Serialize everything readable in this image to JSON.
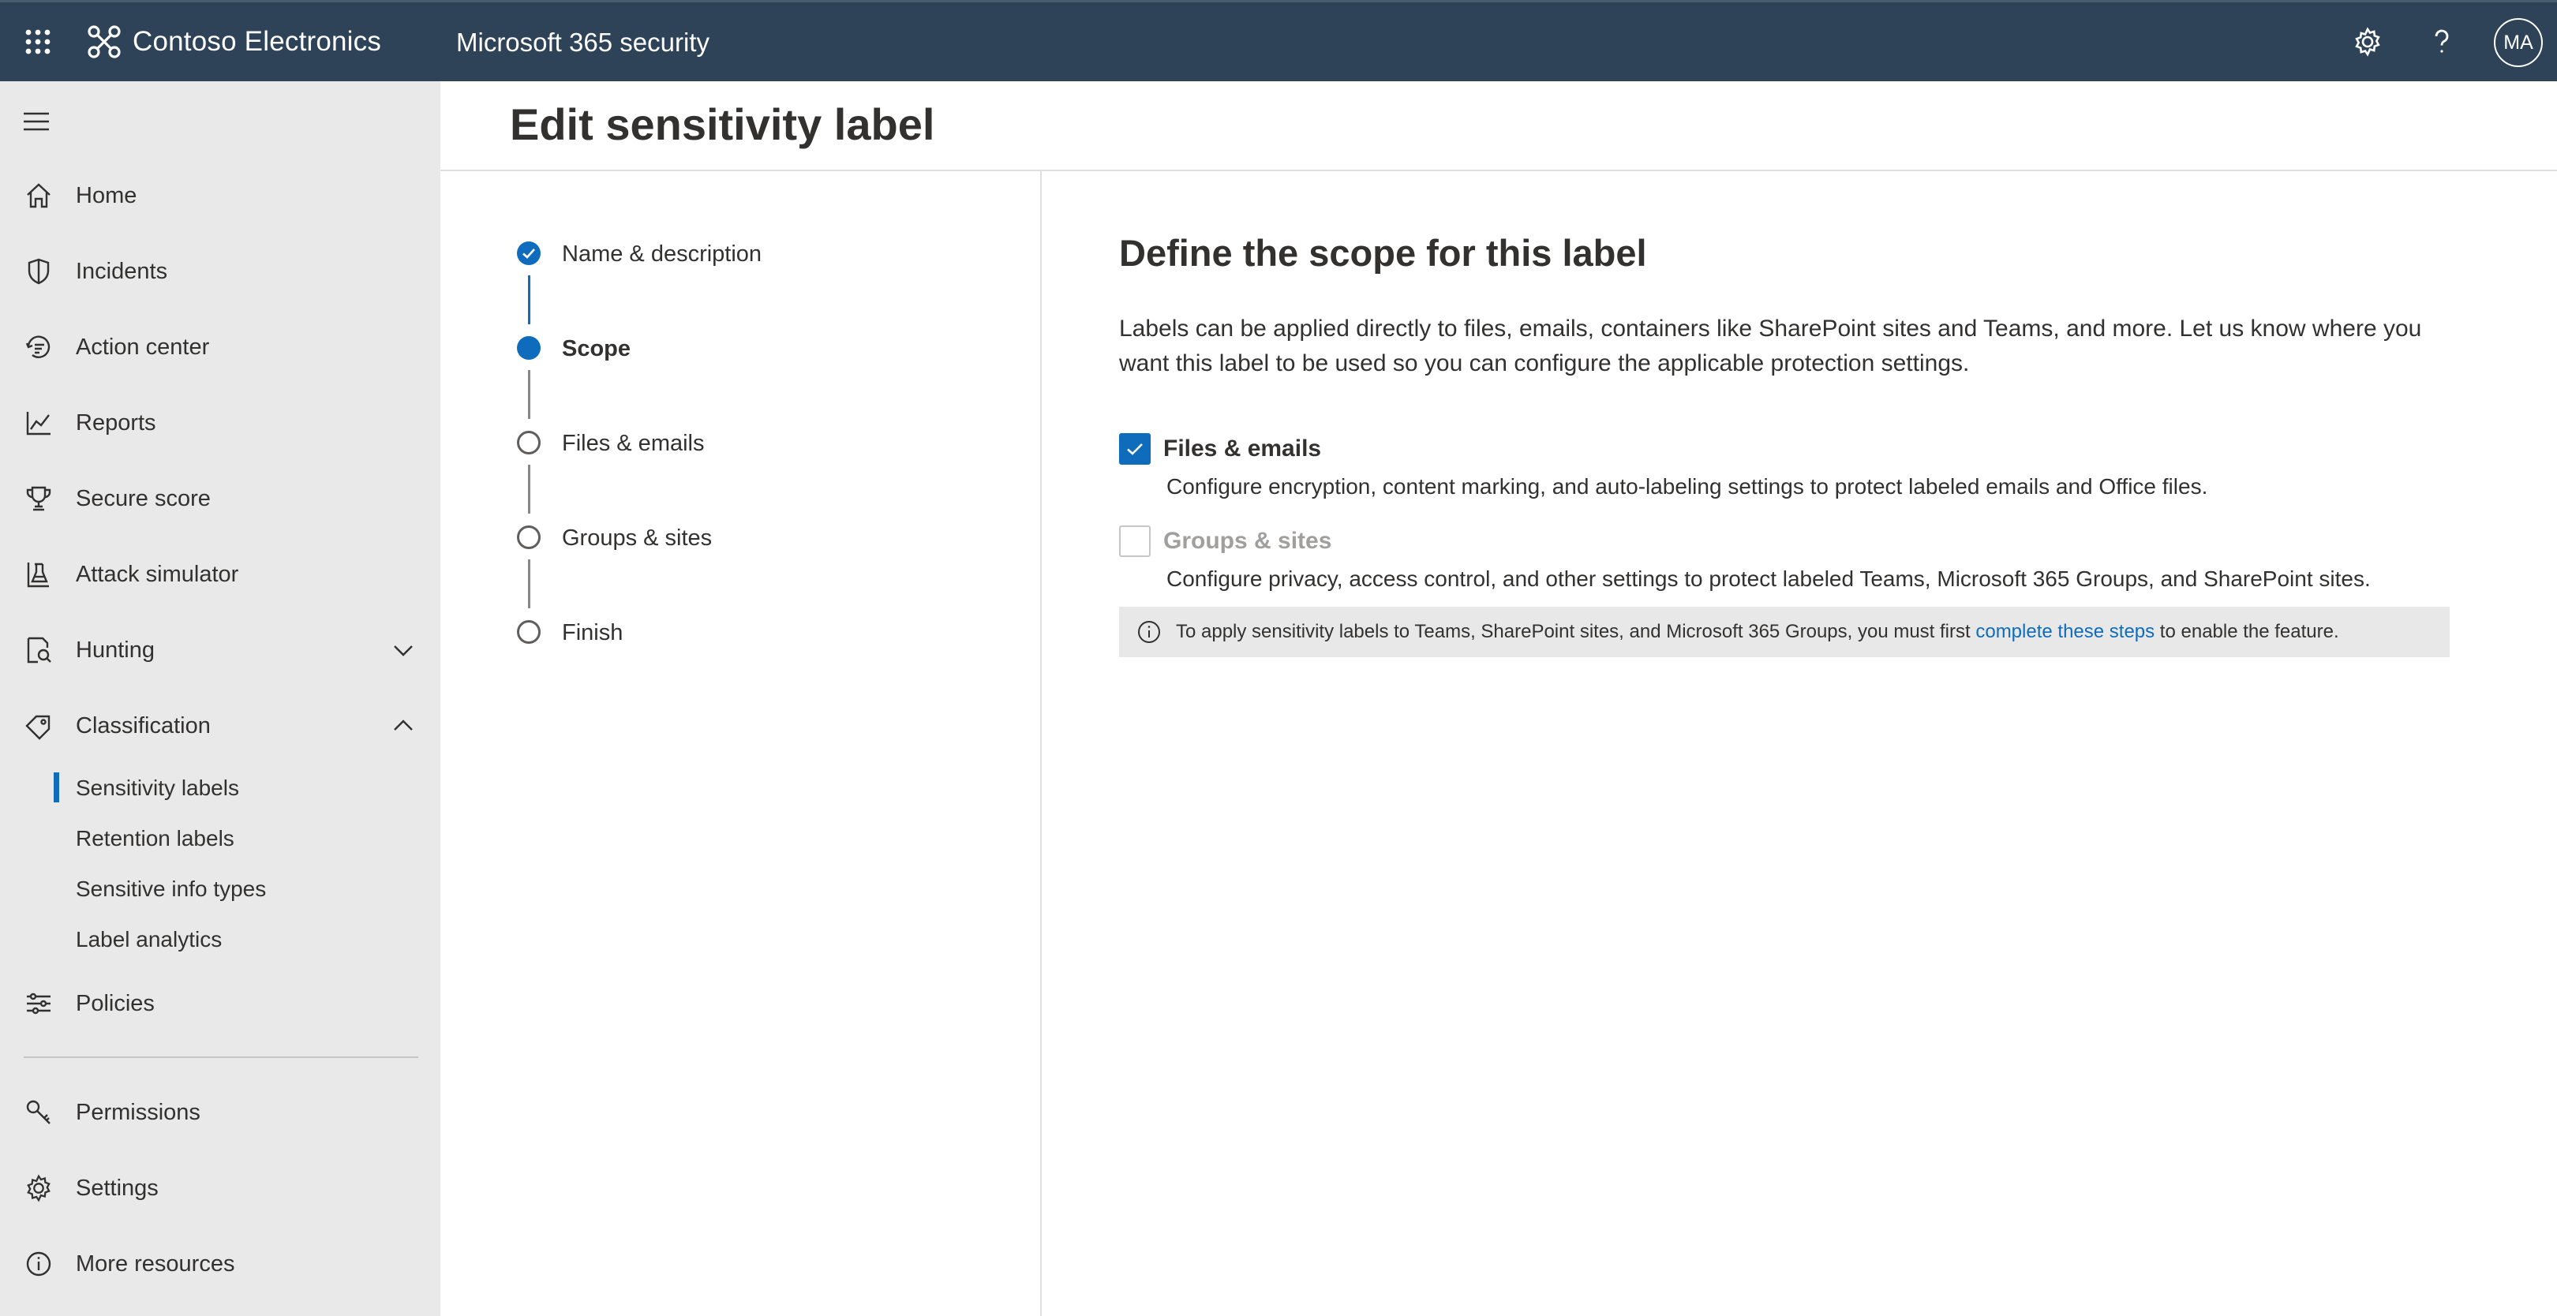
{
  "header": {
    "org_name": "Contoso Electronics",
    "app_title": "Microsoft 365 security",
    "avatar_initials": "MA"
  },
  "nav": {
    "items": [
      {
        "label": "Home",
        "icon": "home-icon"
      },
      {
        "label": "Incidents",
        "icon": "shield-icon"
      },
      {
        "label": "Action center",
        "icon": "action-center-icon"
      },
      {
        "label": "Reports",
        "icon": "chart-line-icon"
      },
      {
        "label": "Secure score",
        "icon": "trophy-icon"
      },
      {
        "label": "Attack simulator",
        "icon": "flask-icon"
      },
      {
        "label": "Hunting",
        "icon": "hunting-icon",
        "expandable": true,
        "expanded": false
      },
      {
        "label": "Classification",
        "icon": "tag-icon",
        "expandable": true,
        "expanded": true
      },
      {
        "label": "Policies",
        "icon": "policies-icon"
      },
      {
        "label": "Permissions",
        "icon": "key-icon"
      },
      {
        "label": "Settings",
        "icon": "gear-icon"
      },
      {
        "label": "More resources",
        "icon": "info-icon"
      }
    ],
    "classification_subitems": [
      {
        "label": "Sensitivity labels",
        "active": true
      },
      {
        "label": "Retention labels",
        "active": false
      },
      {
        "label": "Sensitive info types",
        "active": false
      },
      {
        "label": "Label analytics",
        "active": false
      }
    ]
  },
  "page": {
    "title": "Edit sensitivity label"
  },
  "wizard": {
    "steps": [
      {
        "label": "Name & description",
        "state": "completed"
      },
      {
        "label": "Scope",
        "state": "current"
      },
      {
        "label": "Files & emails",
        "state": "pending"
      },
      {
        "label": "Groups & sites",
        "state": "pending"
      },
      {
        "label": "Finish",
        "state": "pending"
      }
    ]
  },
  "scope": {
    "title": "Define the scope for this label",
    "intro": "Labels can be applied directly to files, emails, containers like SharePoint sites and Teams, and more. Let us know where you want this label to be used so you can configure the applicable protection settings.",
    "options": [
      {
        "label": "Files & emails",
        "checked": true,
        "disabled": false,
        "description": "Configure encryption, content marking, and auto-labeling settings to protect labeled emails and Office files."
      },
      {
        "label": "Groups & sites",
        "checked": false,
        "disabled": true,
        "description": "Configure privacy, access control, and other settings to protect labeled Teams, Microsoft 365 Groups, and SharePoint sites."
      }
    ],
    "info": {
      "text_before": "To apply sensitivity labels to Teams, SharePoint sites, and Microsoft 365 Groups, you must first ",
      "link": "complete these steps",
      "text_after": " to enable the feature."
    }
  },
  "colors": {
    "topbar": "#2e4358",
    "accent": "#0f6cbd",
    "nav_bg": "#e9e9e9"
  }
}
